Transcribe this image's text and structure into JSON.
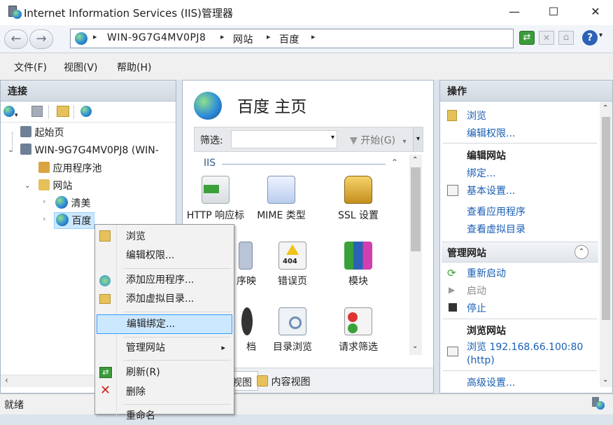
{
  "window": {
    "title": "Internet Information Services (IIS)管理器",
    "minimize": "—",
    "maximize": "☐",
    "close": "✕"
  },
  "address": {
    "crumbs": [
      "WIN-9G7G4MV0PJ8",
      "网站",
      "百度"
    ],
    "separator": "▸"
  },
  "menu": [
    "文件(F)",
    "视图(V)",
    "帮助(H)"
  ],
  "connections": {
    "title": "连接",
    "tree": [
      {
        "label": "起始页",
        "icon": "start-page-icon"
      },
      {
        "label": "WIN-9G7G4MV0PJ8 (WIN-",
        "icon": "server-icon"
      },
      {
        "label": "应用程序池",
        "icon": "app-pool-icon"
      },
      {
        "label": "网站",
        "icon": "sites-folder-icon"
      },
      {
        "label": "清美",
        "icon": "globe-icon"
      },
      {
        "label": "百度",
        "icon": "globe-icon"
      }
    ]
  },
  "center": {
    "title": "百度 主页",
    "filter_label": "筛选:",
    "filter_value": "",
    "start_button": "开始(G)",
    "group_name": "IIS",
    "features_row1": [
      "HTTP 响应标",
      "MIME 类型",
      "SSL 设置"
    ],
    "features_row2": [
      "序映",
      "错误页",
      "模块"
    ],
    "features_row3": [
      "档",
      "目录浏览",
      "请求筛选"
    ],
    "error_page_badge": "404",
    "tabs": [
      "视图",
      "内容视图"
    ]
  },
  "actions": {
    "title": "操作",
    "items": [
      "浏览",
      "编辑权限..."
    ],
    "edit_site_header": "编辑网站",
    "edit_site_items": [
      "绑定...",
      "基本设置..."
    ],
    "view_items": [
      "查看应用程序",
      "查看虚拟目录"
    ],
    "manage_header": "管理网站",
    "manage_items": [
      "重新启动",
      "启动",
      "停止"
    ],
    "browse_header": "浏览网站",
    "browse_link": "浏览 192.168.66.100:80",
    "browse_link2": "(http)",
    "advanced": "高级设置..."
  },
  "status": {
    "text": "就绪"
  },
  "context_menu": {
    "items": [
      "浏览",
      "编辑权限...",
      "添加应用程序...",
      "添加虚拟目录...",
      "编辑绑定...",
      "管理网站",
      "刷新(R)",
      "删除",
      "重命名"
    ],
    "submenu_arrow": "▸"
  },
  "colors": {
    "accent": "#1a5fb4",
    "highlight": "#cce8ff",
    "highlight_border": "#3399ff"
  }
}
